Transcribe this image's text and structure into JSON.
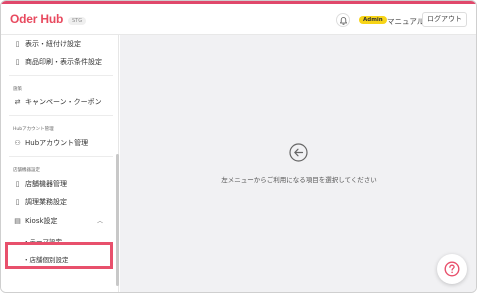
{
  "header": {
    "logo": "Order Hub",
    "logo_prefix": "O",
    "logo_rest": "der Hub",
    "env_badge": "STG",
    "role_badge": "Admin",
    "manual_label": "マニュアル",
    "logout_label": "ログアウト",
    "accent_color": "#e0486b"
  },
  "sidebar": {
    "items_top": [
      {
        "label": "表示・紐付け設定",
        "icon": "document-icon"
      },
      {
        "label": "商品印刷・表示条件設定",
        "icon": "document-icon"
      }
    ],
    "section_campaign": "施策",
    "campaign_item": {
      "label": "キャンペーン・クーポン",
      "icon": "swap-icon"
    },
    "section_hub_account": "Hubアカウント管理",
    "hub_account_item": {
      "label": "Hubアカウント管理",
      "icon": "user-icon"
    },
    "section_store_devices": "店舗機器設定",
    "store_items": [
      {
        "label": "店舗機器管理",
        "icon": "device-icon"
      },
      {
        "label": "調理業務設定",
        "icon": "device-icon"
      },
      {
        "label": "Kiosk設定",
        "icon": "kiosk-icon",
        "expanded": true
      }
    ],
    "kiosk_sub_items": [
      "・テーマ設定",
      "・店舗個別設定"
    ],
    "highlighted_item": "・店舗個別設定",
    "highlight_color": "#e8506c"
  },
  "main": {
    "empty_message": "左メニューからご利用になる項目を選択してください",
    "icon": "arrow-left-circle-icon"
  },
  "help": {
    "icon": "question-circle-icon"
  }
}
